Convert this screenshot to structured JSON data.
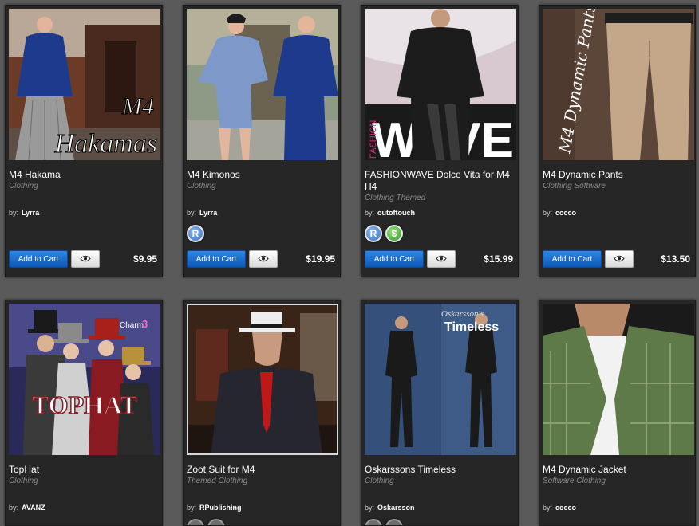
{
  "products": [
    {
      "title": "M4 Hakama",
      "category": "Clothing",
      "by_label": "by:",
      "author": "Lyrra",
      "badges": [],
      "add_to_cart": "Add to Cart",
      "price": "$9.95",
      "image": {
        "overlay_text": [
          "M4",
          "Hakamas"
        ]
      }
    },
    {
      "title": "M4 Kimonos",
      "category": "Clothing",
      "by_label": "by:",
      "author": "Lyrra",
      "badges": [
        "R"
      ],
      "add_to_cart": "Add to Cart",
      "price": "$19.95",
      "image": {
        "overlay_text": []
      }
    },
    {
      "title": "FASHIONWAVE Dolce Vita for M4 H4",
      "category": "Clothing Themed",
      "by_label": "by:",
      "author": "outoftouch",
      "badges": [
        "R",
        "$"
      ],
      "add_to_cart": "Add to Cart",
      "price": "$15.99",
      "image": {
        "overlay_text": [
          "WAVE",
          "FASHION"
        ]
      }
    },
    {
      "title": "M4 Dynamic Pants",
      "category": "Clothing Software",
      "by_label": "by:",
      "author": "cocco",
      "badges": [],
      "add_to_cart": "Add to Cart",
      "price": "$13.50",
      "image": {
        "overlay_text": [
          "M4 Dynamic Pants"
        ]
      }
    },
    {
      "title": "TopHat",
      "category": "Clothing",
      "by_label": "by:",
      "author": "AVANZ",
      "badges": [],
      "image": {
        "overlay_text": [
          "TOPHAT",
          "Charm",
          "3"
        ]
      }
    },
    {
      "title": "Zoot Suit for M4",
      "category": "Themed Clothing",
      "by_label": "by:",
      "author": "RPublishing",
      "badges": [
        "",
        ""
      ],
      "image": {
        "overlay_text": []
      }
    },
    {
      "title": "Oskarssons Timeless",
      "category": "Clothing",
      "by_label": "by:",
      "author": "Oskarsson",
      "badges": [
        "",
        ""
      ],
      "image": {
        "overlay_text": [
          "Oskarsson's",
          "Timeless"
        ]
      }
    },
    {
      "title": "M4 Dynamic Jacket",
      "category": "Software Clothing",
      "by_label": "by:",
      "author": "cocco",
      "badges": [],
      "image": {
        "overlay_text": []
      }
    }
  ],
  "icons": {
    "preview": "eye-icon",
    "badge_r": "R",
    "badge_s": "$"
  },
  "colors": {
    "page_bg": "#5a5a5a",
    "card_bg": "#262626",
    "cart_button": "#1f6fd4",
    "category_text": "#8a8a8a"
  }
}
